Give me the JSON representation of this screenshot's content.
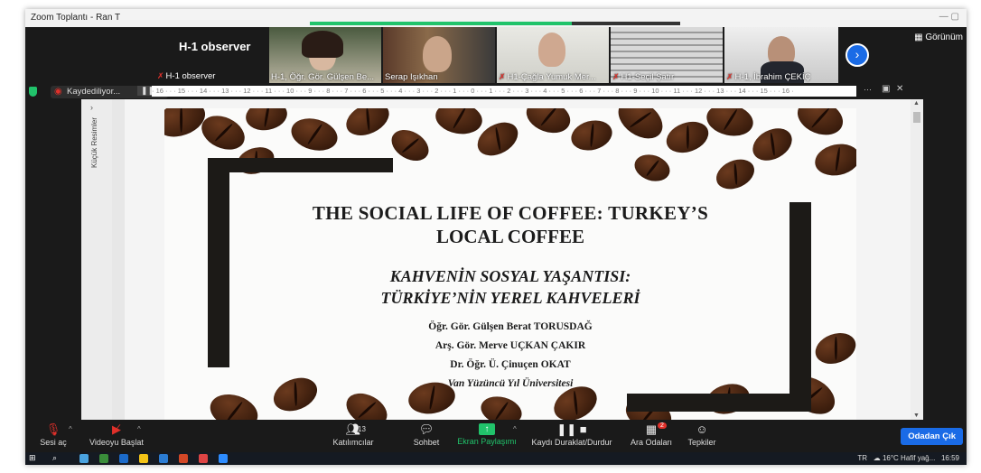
{
  "window": {
    "title": "Zoom Toplantı - Ran T"
  },
  "participants_strip": {
    "self_name": "H-1 observer",
    "self_label": "H-1 observer",
    "tiles": [
      {
        "name": "H-1, Öğr. Gör. Gülşen Be...",
        "muted": false
      },
      {
        "name": "Serap Işıkhan",
        "muted": false
      },
      {
        "name": "H1-Çağla Yumuk Mer...",
        "muted": true
      },
      {
        "name": "H1-Seçil Şatır",
        "muted": true
      },
      {
        "name": "H-1, İbrahim ÇEKİÇ",
        "muted": true
      }
    ],
    "view_label": "Görünüm"
  },
  "recording": {
    "label": "Kaydediliyor..."
  },
  "document": {
    "thumbnails_label": "Küçük Resimler",
    "ruler_text": "· 16 · · · 15 · · · 14 · · · 13 · · · 12 · · · 11 · · · 10 · · · 9 · · · 8 · · · 7 · · · 6 · · · 5 · · · 4 · · · 3 · · · 2 · · · 1 · · · 0 · · · 1 · · · 2 · · · 3 · · · 4 · · · 5 · · · 6 · · · 7 · · · 8 · · · 9 · · · 10 · · · 11 · · · 12 · · · 13 · · · 14 · · · 15 · · · 16 ·"
  },
  "slide": {
    "title_line1": "THE SOCIAL LIFE OF COFFEE: TURKEY’S",
    "title_line2": "LOCAL COFFEE",
    "subtitle_line1": "KAHVENİN SOSYAL YAŞANTISI:",
    "subtitle_line2": "TÜRKİYE’NİN YEREL KAHVELERİ",
    "author1": "Öğr. Gör. Gülşen Berat TORUSDAĞ",
    "author2": "Arş. Gör. Merve UÇKAN ÇAKIR",
    "author3": "Dr. Öğr. Ü. Çinuçen OKAT",
    "institution": "Van Yüzüncü Yıl Üniversitesi"
  },
  "toolbar": {
    "unmute": "Sesi aç",
    "start_video": "Videoyu Başlat",
    "participants": "Katılımcılar",
    "participants_count": "13",
    "chat": "Sohbet",
    "share_screen": "Ekran Paylaşımı",
    "pause_stop_recording": "Kaydı Duraklat/Durdur",
    "breakout_rooms": "Ara Odaları",
    "breakout_badge": "2",
    "reactions": "Tepkiler",
    "leave": "Odadan Çık"
  },
  "taskbar": {
    "lang": "TR",
    "weather": "16°C  Hafif yağ...",
    "time": "16:59"
  },
  "colors": {
    "accent_blue": "#1a6be6",
    "share_green": "#21c36b",
    "mute_red": "#e0302a"
  }
}
